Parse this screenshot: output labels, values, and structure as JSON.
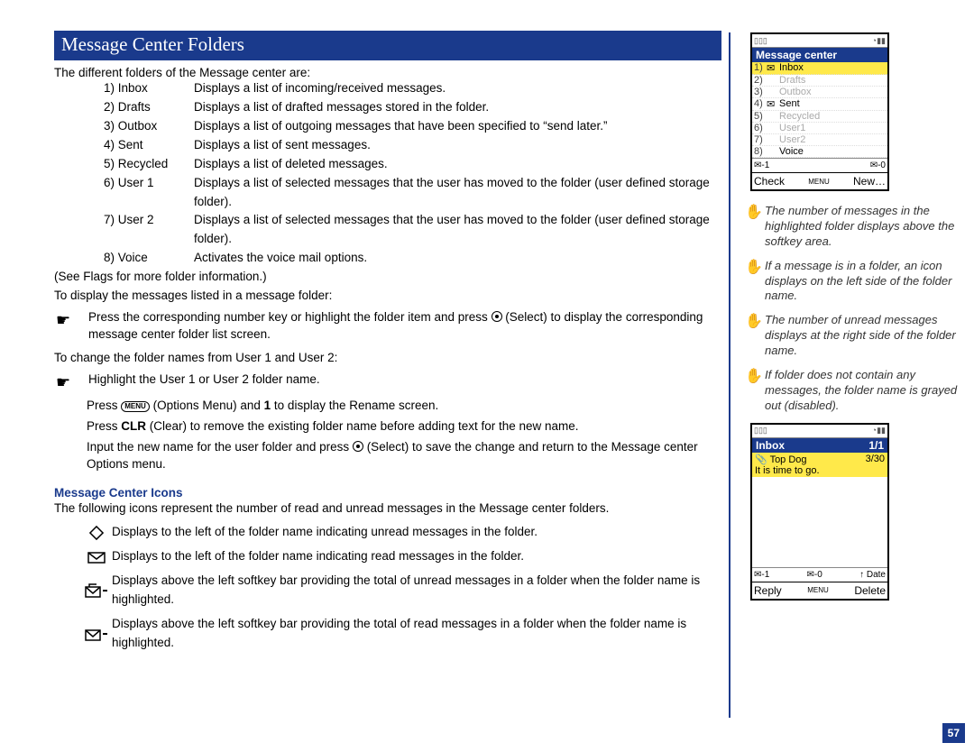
{
  "titlebar": "Message Center Folders",
  "intro": "The different folders of the Message center are:",
  "folders": [
    {
      "num": "1) Inbox",
      "desc": "Displays a list of incoming/received messages."
    },
    {
      "num": "2) Drafts",
      "desc": "Displays a list of drafted messages stored in the folder."
    },
    {
      "num": "3) Outbox",
      "desc": "Displays a list of outgoing messages that have been specified to “send later.”"
    },
    {
      "num": "4) Sent",
      "desc": "Displays a list of sent messages."
    },
    {
      "num": "5) Recycled",
      "desc": "Displays a list of deleted messages."
    },
    {
      "num": "6) User 1",
      "desc": "Displays a list of selected messages that the user has moved to the folder (user defined storage folder)."
    },
    {
      "num": "7) User 2",
      "desc": "Displays a list of selected messages that the user has moved to the folder (user defined storage folder)."
    },
    {
      "num": "8) Voice",
      "desc": "Activates the voice mail options."
    }
  ],
  "see_flags": "(See Flags for more folder information.)",
  "to_display_heading": "To display the messages listed in a message folder:",
  "bullet1_a": "Press the corresponding number key or highlight the folder item and press ",
  "bullet1_b": " (Select) to display the corresponding message center folder list screen.",
  "to_change_heading": "To change the folder names from User 1 and User 2:",
  "bullet2": "Highlight the User 1 or User 2 folder name.",
  "step_a1": "Press ",
  "step_a2": " (Options Menu) and ",
  "step_a3_bold": "1",
  "step_a4": " to display the Rename screen.",
  "step_b1": "Press ",
  "step_b2_bold": "CLR",
  "step_b3": " (Clear) to remove the existing folder name before adding text for the new name.",
  "step_c1": "Input the new name for the user folder and press ",
  "step_c2": " (Select) to save the change and return to the Message center Options menu.",
  "icons_heading": "Message Center Icons",
  "icons_intro": "The following icons represent the number of read and unread messages in the Message center folders.",
  "icon_rows": [
    "Displays to the left of the folder name indicating unread messages in the folder.",
    "Displays to the left of the folder name indicating read messages in the folder.",
    "Displays above the left softkey bar providing the total of unread messages in a folder when the folder name is highlighted.",
    "Displays above the left softkey bar providing the total of read messages in a folder when the folder name is highlighted."
  ],
  "phone1": {
    "title": "Message center",
    "rows": [
      {
        "n": "1)",
        "t": "Inbox",
        "sel": true,
        "dim": false,
        "icon": "env"
      },
      {
        "n": "2)",
        "t": "Drafts",
        "sel": false,
        "dim": true,
        "icon": null
      },
      {
        "n": "3)",
        "t": "Outbox",
        "sel": false,
        "dim": true,
        "icon": null
      },
      {
        "n": "4)",
        "t": "Sent",
        "sel": false,
        "dim": false,
        "icon": "env"
      },
      {
        "n": "5)",
        "t": "Recycled",
        "sel": false,
        "dim": true,
        "icon": null
      },
      {
        "n": "6)",
        "t": "User1",
        "sel": false,
        "dim": true,
        "icon": null
      },
      {
        "n": "7)",
        "t": "User2",
        "sel": false,
        "dim": true,
        "icon": null
      },
      {
        "n": "8)",
        "t": "Voice",
        "sel": false,
        "dim": false,
        "icon": null
      }
    ],
    "foot_left": "✉-1",
    "foot_right": "✉-0",
    "soft_left": "Check",
    "soft_mid": "MENU",
    "soft_right": "New…"
  },
  "notes": [
    "The number of messages in the highlighted folder displays above the softkey area.",
    "If a message is in a folder, an icon displays on the left side of the folder name.",
    "The number of unread messages displays at the right side of the folder name.",
    "If folder does not contain any messages, the folder name is grayed out (disabled)."
  ],
  "phone2": {
    "title": "Inbox",
    "title_right": "1/1",
    "msg_from": "Top Dog",
    "msg_count": "3/30",
    "msg_body": "It is time to go.",
    "foot_left": "✉-1",
    "foot_mid": "✉-0",
    "foot_right": "↑ Date",
    "soft_left": "Reply",
    "soft_mid": "MENU",
    "soft_right": "Delete"
  },
  "page_number": "57"
}
